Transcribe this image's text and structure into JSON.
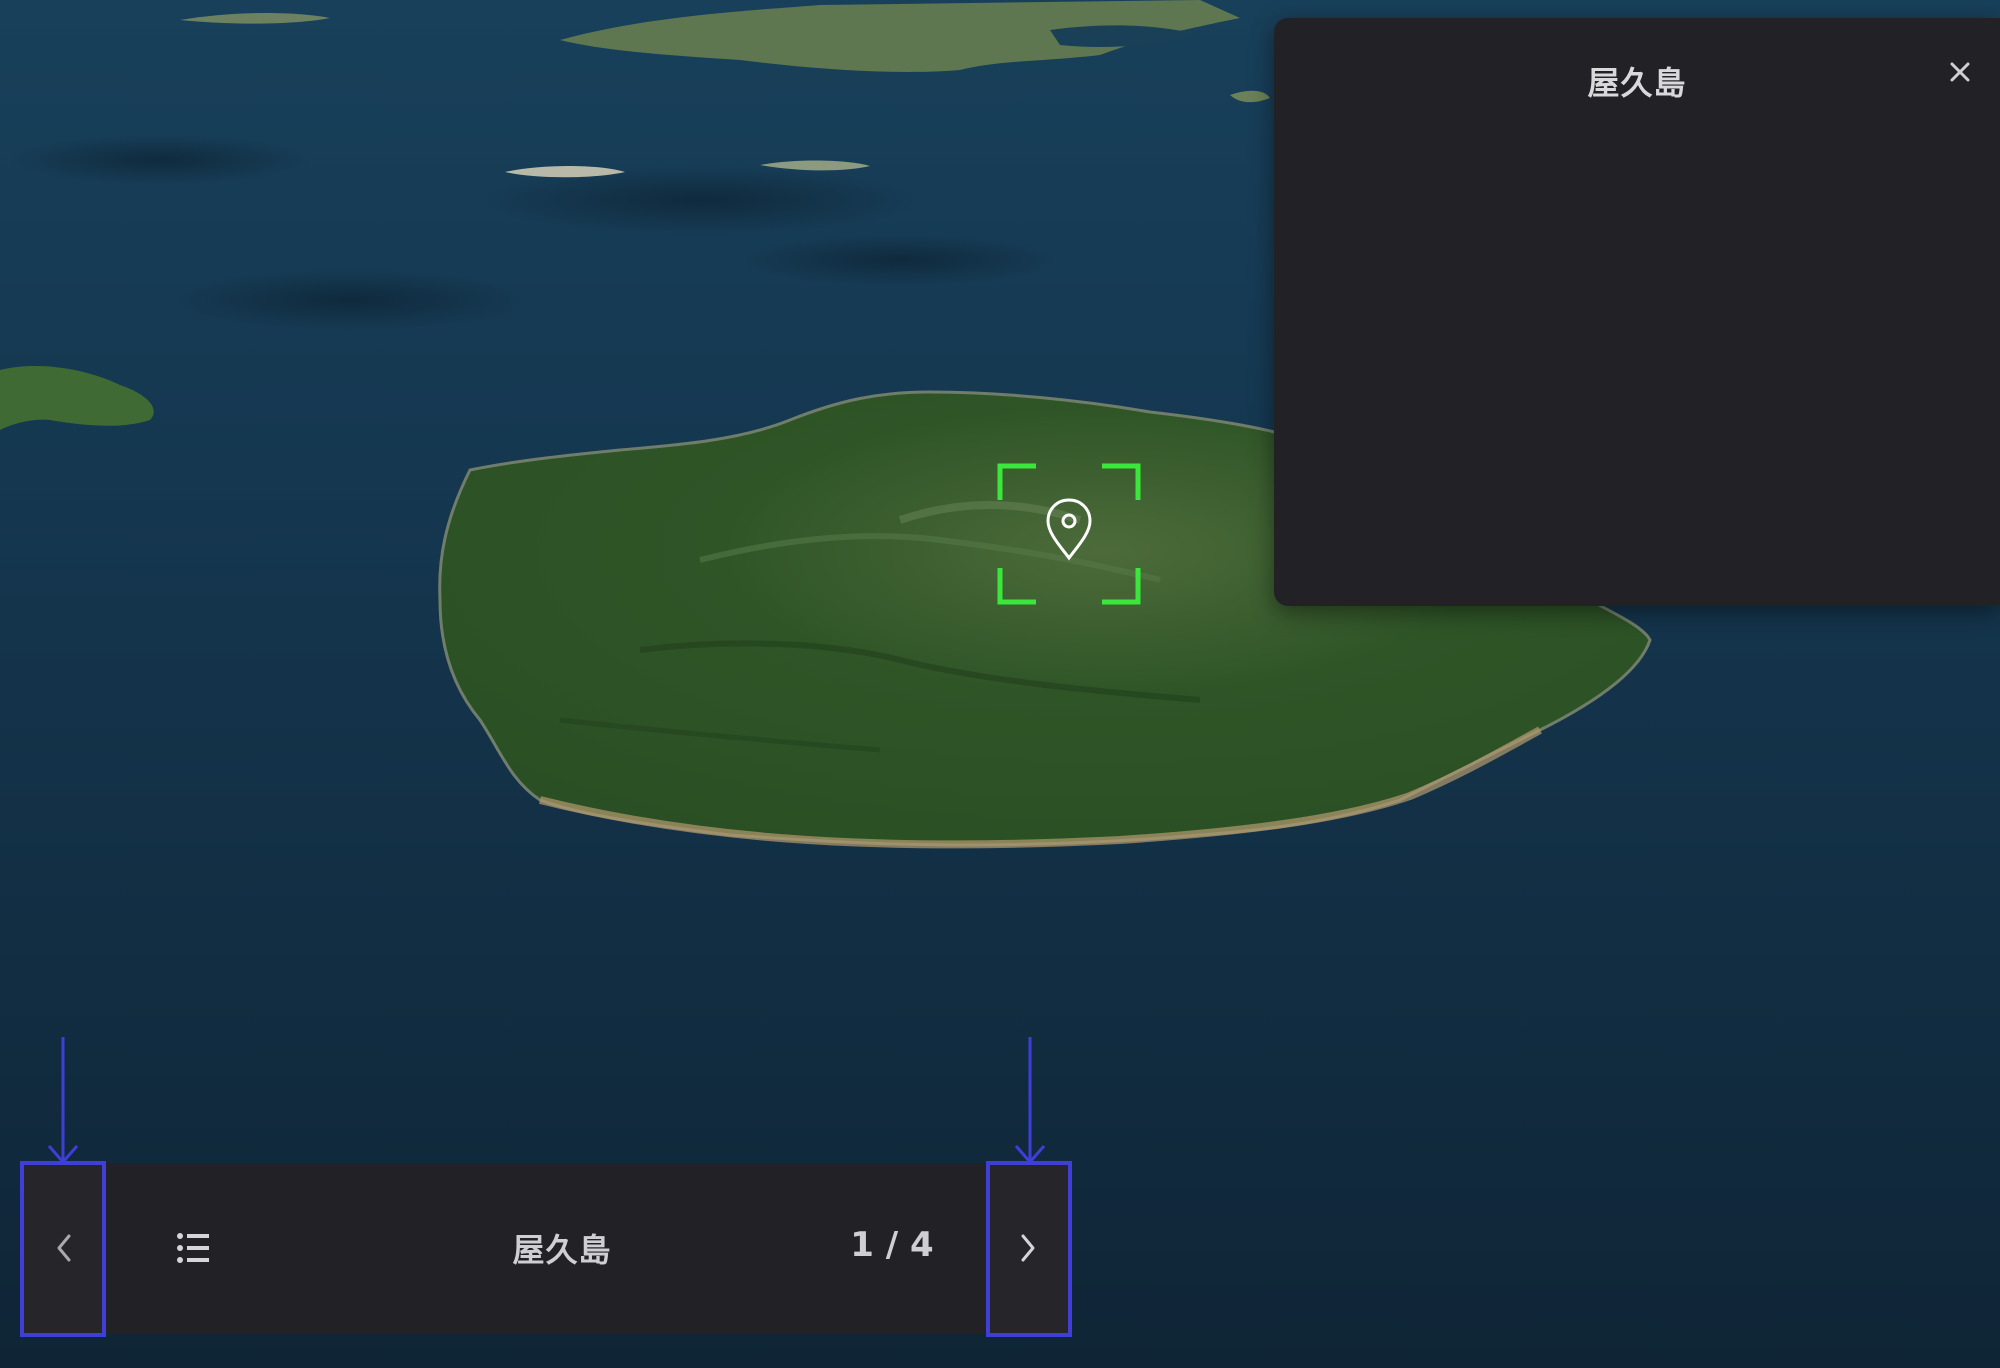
{
  "map": {
    "center_marker_icon": "location-pin-icon",
    "focus_frame_color": "#39e83a"
  },
  "info_panel": {
    "title": "屋久島",
    "close_icon": "close-icon"
  },
  "tour_bar": {
    "prev_icon": "chevron-left-icon",
    "list_icon": "list-icon",
    "title": "屋久島",
    "counter": "1 / 4",
    "next_icon": "chevron-right-icon"
  },
  "colors": {
    "panel_bg": "#222126",
    "annotation": "#3f3fd8",
    "ocean": "#13334a",
    "land": "#2f5a2a"
  }
}
